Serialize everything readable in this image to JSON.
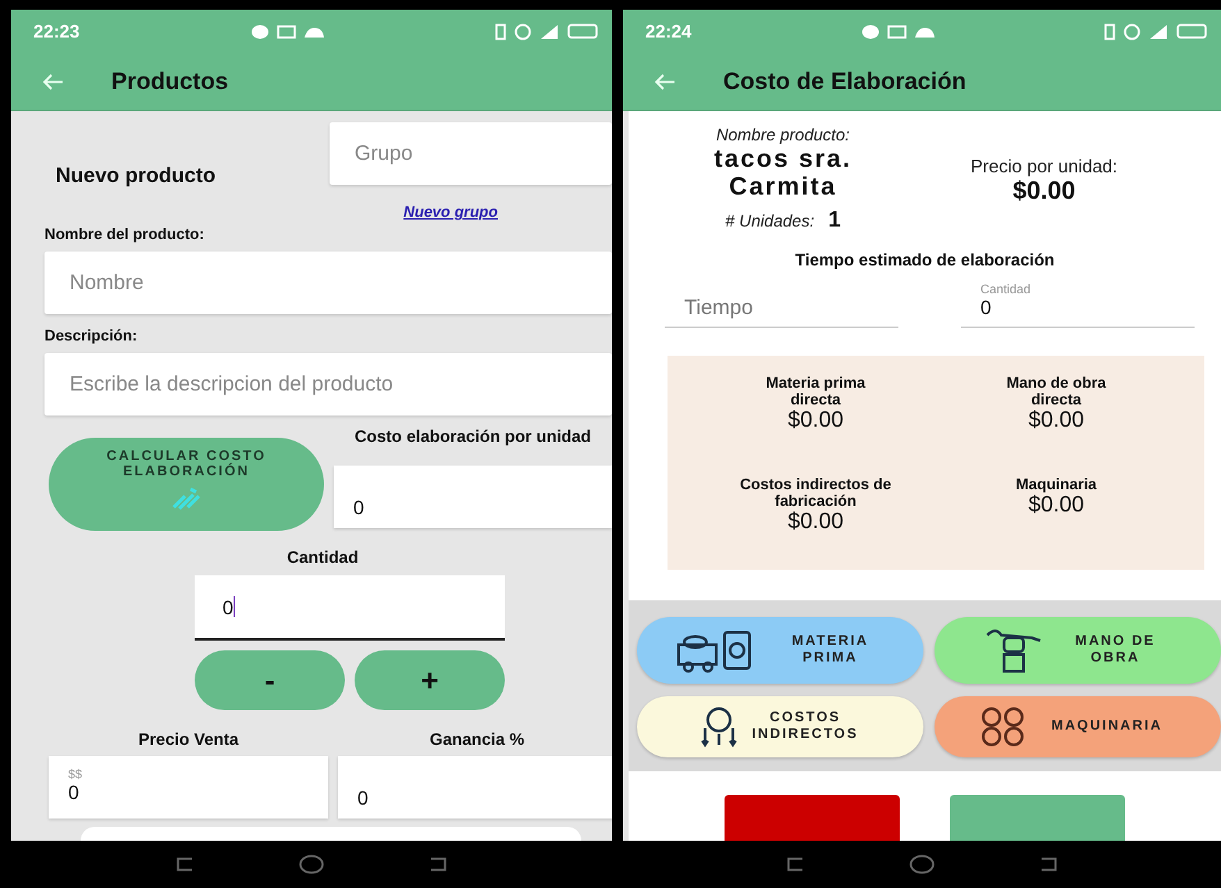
{
  "productos_screen": {
    "status_bar": {
      "time": "22:23"
    },
    "title": "Productos",
    "heading": "Nuevo producto",
    "group_field": {
      "placeholder": "Grupo"
    },
    "new_group_link": "Nuevo grupo",
    "name_label": "Nombre del producto:",
    "name_field": {
      "placeholder": "Nombre"
    },
    "description_label": "Descripción:",
    "description_field": {
      "placeholder": "Escribe la descripcion del producto"
    },
    "calculate_button": "CALCULAR COSTO ELABORACIÓN",
    "unit_cost_label": "Costo elaboración por unidad",
    "unit_cost_field": {
      "value": "0"
    },
    "quantity_label": "Cantidad",
    "quantity_field": {
      "value": "0"
    },
    "minus_button": "-",
    "plus_button": "+",
    "price_label": "Precio Venta",
    "price_field": {
      "label": "$$",
      "value": "0"
    },
    "profit_label": "Ganancia %",
    "profit_field": {
      "value": "0"
    }
  },
  "costo_screen": {
    "status_bar": {
      "time": "22:24"
    },
    "title": "Costo de Elaboración",
    "product_label": "Nombre producto:",
    "product_name": "tacos sra. Carmita",
    "unit_price_label": "Precio por unidad:",
    "unit_price": "$0.00",
    "units_label": "# Unidades:",
    "units": "1",
    "time_heading": "Tiempo estimado de elaboración",
    "time_field": {
      "placeholder": "Tiempo"
    },
    "amount_field": {
      "label": "Cantidad",
      "value": "0"
    },
    "costs": [
      {
        "label": "Materia prima directa",
        "value": "$0.00"
      },
      {
        "label": "Mano de obra directa",
        "value": "$0.00"
      },
      {
        "label": "Costos indirectos de fabricación",
        "value": "$0.00"
      },
      {
        "label": "Maquinaria",
        "value": "$0.00"
      }
    ],
    "category_buttons": [
      {
        "label": "MATERIA PRIMA",
        "kind": "materials",
        "color": "#8ccbf5"
      },
      {
        "label": "MANO DE OBRA",
        "kind": "labor",
        "color": "#8ee68e"
      },
      {
        "label": "COSTOS INDIRECTOS",
        "kind": "indirect",
        "color": "#fbf8dc"
      },
      {
        "label": "MAQUINARIA",
        "kind": "machinery",
        "color": "#f4a27a"
      }
    ]
  }
}
